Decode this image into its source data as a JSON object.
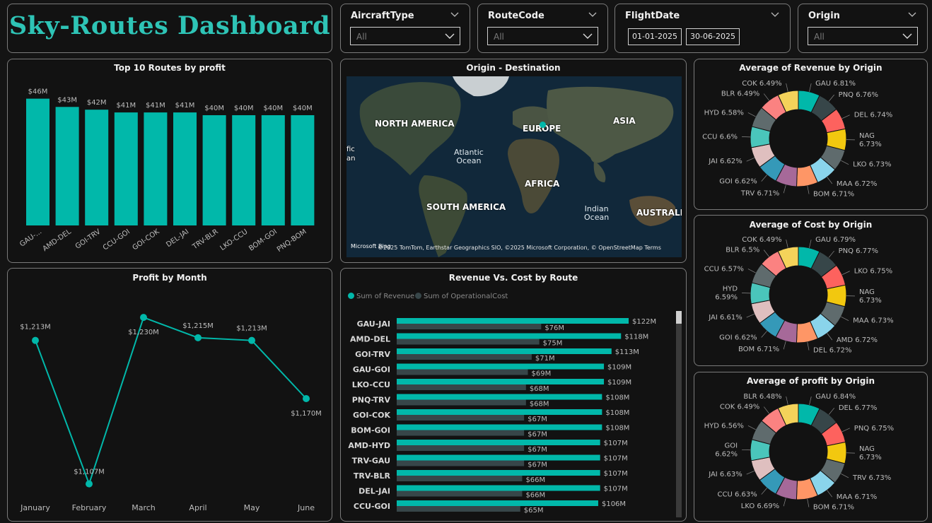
{
  "app": {
    "title": "Sky-Routes Dashboard"
  },
  "slicers": {
    "aircraft": {
      "label": "AircraftType",
      "value": "All"
    },
    "route": {
      "label": "RouteCode",
      "value": "All"
    },
    "date": {
      "label": "FlightDate",
      "start": "01-01-2025",
      "end": "30-06-2025"
    },
    "origin": {
      "label": "Origin",
      "value": "All"
    }
  },
  "colors": {
    "accent": "#01b8aa",
    "cost": "#374649",
    "title": "#2ec4b6"
  },
  "top_routes": {
    "title": "Top 10 Routes by profit",
    "chart_data": {
      "type": "bar",
      "categories": [
        "GAU-...",
        "AMD-DEL",
        "GOI-TRV",
        "CCU-GOI",
        "GOI-COK",
        "DEL-JAI",
        "TRV-BLR",
        "LKO-CCU",
        "BOM-GOI",
        "PNQ-BOM"
      ],
      "values": [
        46,
        43,
        42,
        41,
        41,
        41,
        40,
        40,
        40,
        40
      ],
      "labels": [
        "$46M",
        "$43M",
        "$42M",
        "$41M",
        "$41M",
        "$41M",
        "$40M",
        "$40M",
        "$40M",
        "$40M"
      ],
      "ylim": [
        0,
        50
      ]
    }
  },
  "map": {
    "title": "Origin - Destination",
    "labels": {
      "na": "NORTH AMERICA",
      "eu": "EUROPE",
      "asia": "ASIA",
      "africa": "AFRICA",
      "sa": "SOUTH AMERICA",
      "aus": "AUSTRALIA",
      "pac": "fic",
      "pac2": "an"
    },
    "oceans": {
      "atl1": "Atlantic",
      "atl2": "Ocean",
      "ind1": "Indian",
      "ind2": "Ocean"
    },
    "attribution": "©2025 TomTom, Earthstar Geographics SIO, ©2025 Microsoft Corporation, © OpenStreetMap  Terms",
    "logo": "Microsoft Bing"
  },
  "profit_month": {
    "title": "Profit by Month",
    "chart_data": {
      "type": "line",
      "categories": [
        "January",
        "February",
        "March",
        "April",
        "May",
        "June"
      ],
      "values": [
        1213,
        1107,
        1230,
        1215,
        1213,
        1170
      ],
      "labels": [
        "$1,213M",
        "$1,107M",
        "$1,230M",
        "$1,215M",
        "$1,213M",
        "$1,170M"
      ]
    }
  },
  "rev_cost": {
    "title": "Revenue Vs. Cost by Route",
    "legend": {
      "revenue": "Sum of Revenue",
      "cost": "Sum of OperationalCost"
    },
    "chart_data": {
      "type": "bar",
      "orientation": "horizontal",
      "categories": [
        "GAU-JAI",
        "AMD-DEL",
        "GOI-TRV",
        "GAU-GOI",
        "LKO-CCU",
        "PNQ-TRV",
        "GOI-COK",
        "BOM-GOI",
        "AMD-HYD",
        "TRV-GAU",
        "TRV-BLR",
        "DEL-JAI",
        "CCU-GOI"
      ],
      "series": [
        {
          "name": "Sum of Revenue",
          "values": [
            122,
            118,
            113,
            109,
            109,
            108,
            108,
            108,
            107,
            107,
            107,
            107,
            106
          ],
          "labels": [
            "$122M",
            "$118M",
            "$113M",
            "$109M",
            "$109M",
            "$108M",
            "$108M",
            "$108M",
            "$107M",
            "$107M",
            "$107M",
            "$107M",
            "$106M"
          ]
        },
        {
          "name": "Sum of OperationalCost",
          "values": [
            76,
            75,
            71,
            69,
            68,
            68,
            67,
            67,
            67,
            67,
            66,
            66,
            65
          ],
          "labels": [
            "$76M",
            "$75M",
            "$71M",
            "$69M",
            "$68M",
            "$68M",
            "$67M",
            "$67M",
            "$67M",
            "$67M",
            "$66M",
            "$66M",
            "$65M"
          ]
        }
      ]
    }
  },
  "donut_revenue": {
    "title": "Average of Revenue by Origin",
    "chart_data": {
      "type": "pie",
      "labels": [
        "GAU",
        "PNQ",
        "DEL",
        "NAG",
        "LKO",
        "MAA",
        "BOM",
        "TRV",
        "GOI",
        "JAI",
        "CCU",
        "HYD",
        "BLR",
        "COK"
      ],
      "values": [
        6.81,
        6.76,
        6.74,
        6.73,
        6.73,
        6.72,
        6.71,
        6.71,
        6.62,
        6.62,
        6.6,
        6.58,
        6.49,
        6.49
      ],
      "display": [
        "GAU 6.81%",
        "PNQ 6.76%",
        "DEL 6.74%",
        "NAG\n6.73%",
        "LKO 6.73%",
        "MAA 6.72%",
        "BOM 6.71%",
        "TRV 6.71%",
        "GOI 6.62%",
        "JAI 6.62%",
        "CCU 6.6%",
        "HYD 6.58%",
        "BLR 6.49%",
        "COK 6.49%"
      ]
    }
  },
  "donut_cost": {
    "title": "Average of Cost by Origin",
    "chart_data": {
      "type": "pie",
      "labels": [
        "GAU",
        "PNQ",
        "LKO",
        "NAG",
        "MAA",
        "AMD",
        "DEL",
        "BOM",
        "GOI",
        "JAI",
        "HYD",
        "CCU",
        "BLR",
        "COK"
      ],
      "values": [
        6.79,
        6.77,
        6.75,
        6.73,
        6.73,
        6.72,
        6.72,
        6.71,
        6.62,
        6.61,
        6.59,
        6.57,
        6.5,
        6.49
      ],
      "display": [
        "GAU 6.79%",
        "PNQ 6.77%",
        "LKO 6.75%",
        "NAG\n6.73%",
        "MAA 6.73%",
        "AMD 6.72%",
        "DEL 6.72%",
        "BOM 6.71%",
        "GOI 6.62%",
        "JAI 6.61%",
        "HYD\n6.59%",
        "CCU 6.57%",
        "BLR 6.5%",
        "COK 6.49%"
      ]
    }
  },
  "donut_profit": {
    "title": "Average of profit by Origin",
    "chart_data": {
      "type": "pie",
      "labels": [
        "GAU",
        "DEL",
        "PNQ",
        "NAG",
        "TRV",
        "MAA",
        "BOM",
        "LKO",
        "CCU",
        "JAI",
        "GOI",
        "HYD",
        "COK",
        "BLR"
      ],
      "values": [
        6.84,
        6.77,
        6.75,
        6.73,
        6.73,
        6.71,
        6.71,
        6.69,
        6.63,
        6.63,
        6.62,
        6.56,
        6.49,
        6.48
      ],
      "display": [
        "GAU 6.84%",
        "DEL 6.77%",
        "PNQ 6.75%",
        "NAG\n6.73%",
        "TRV 6.73%",
        "MAA 6.71%",
        "BOM 6.71%",
        "LKO 6.69%",
        "CCU 6.63%",
        "JAI 6.63%",
        "GOI\n6.62%",
        "HYD 6.56%",
        "COK 6.49%",
        "BLR 6.48%"
      ]
    }
  }
}
